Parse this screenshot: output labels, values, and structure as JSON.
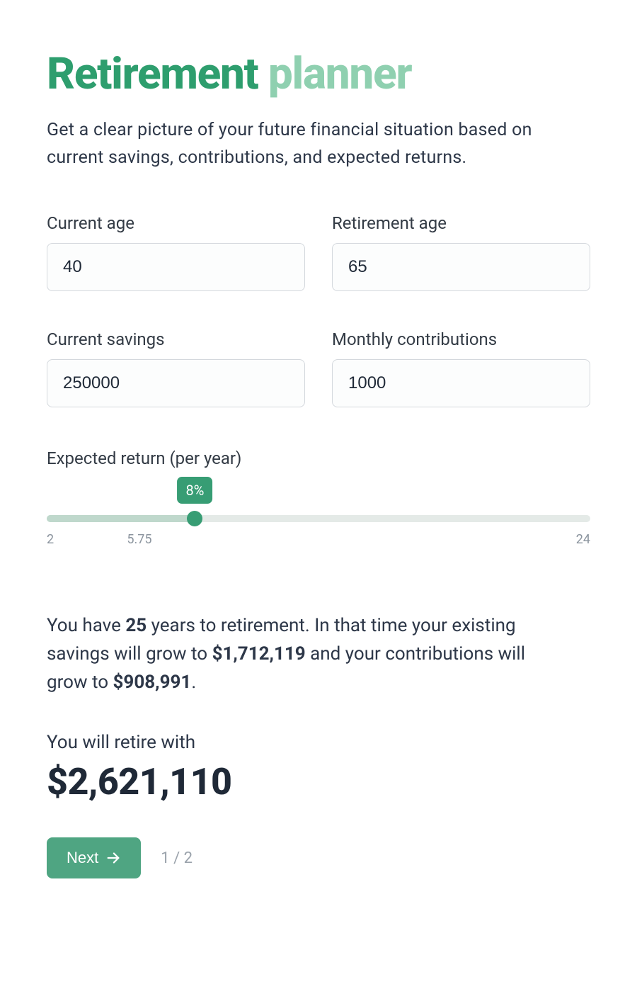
{
  "title": {
    "word1": "Retirement",
    "word2": "planner"
  },
  "subtitle": "Get a clear picture of your future financial situation based on current savings, contributions, and expected returns.",
  "fields": {
    "current_age": {
      "label": "Current age",
      "value": "40"
    },
    "retirement_age": {
      "label": "Retirement age",
      "value": "65"
    },
    "current_savings": {
      "label": "Current savings",
      "value": "250000"
    },
    "monthly_contrib": {
      "label": "Monthly contributions",
      "value": "1000"
    }
  },
  "slider": {
    "label": "Expected return (per year)",
    "min": 2,
    "mid": 5.75,
    "max": 24,
    "value": 8,
    "badge": "8%",
    "min_text": "2",
    "mid_text": "5.75",
    "max_text": "24"
  },
  "summary": {
    "pre_years": "You have ",
    "years": "25",
    "post_years": " years to retirement. In that time your existing savings will grow to ",
    "savings_grow": "$1,712,119",
    "mid": " and your contributions will grow to ",
    "contrib_grow": "$908,991",
    "end": "."
  },
  "retire": {
    "label": "You will retire with",
    "value": "$2,621,110"
  },
  "footer": {
    "next_label": "Next",
    "page_indicator": "1 / 2"
  }
}
